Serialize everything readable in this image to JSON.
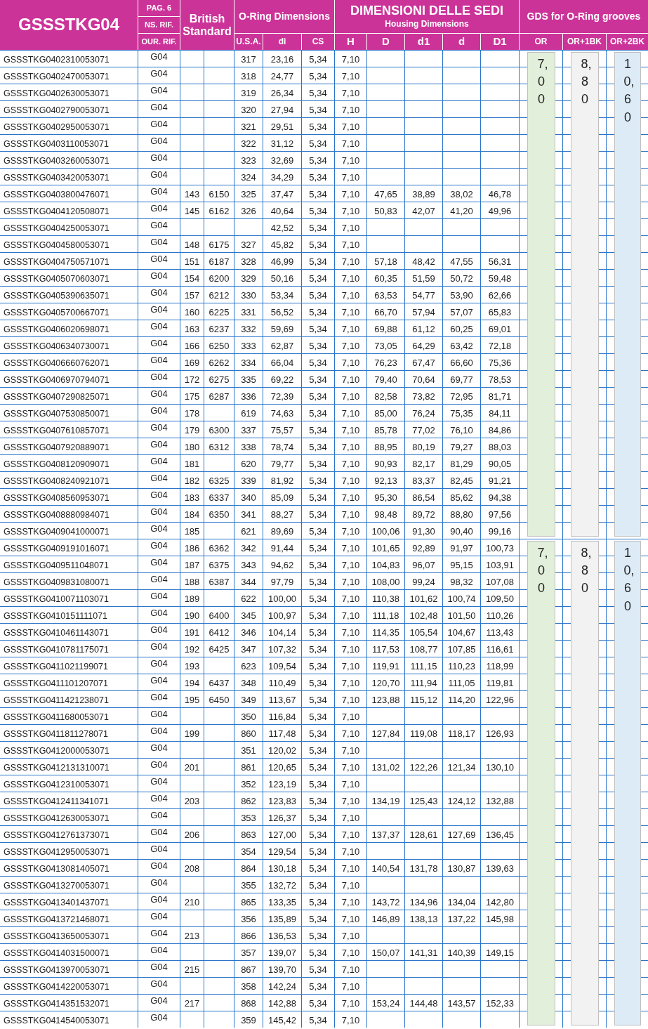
{
  "header": {
    "title": "GSSSTKG04",
    "page": "PAG. 6",
    "ns_ref": "NS. RIF.",
    "our_ref": "OUR. RIF.",
    "british_standard": "British Standard",
    "oring_group": "O-Ring Dimensions",
    "oring_columns": [
      "U.S.A.",
      "di",
      "CS"
    ],
    "housing_group": "DIMENSIONI DELLE SEDI",
    "housing_subtitle": "Housing Dimensions",
    "housing_columns": [
      "H",
      "D",
      "d1",
      "d",
      "D1"
    ],
    "grooves_group": "GDS for O-Ring grooves",
    "grooves_columns": [
      "OR",
      "OR+1BK",
      "OR+2BK"
    ]
  },
  "blocks": [
    {
      "grooves": [
        {
          "value": "7,00",
          "color": "#e2efda"
        },
        {
          "value": "8,80",
          "color": "#f2f2f2"
        },
        {
          "value": "10,60",
          "color": "#ddebf7"
        }
      ],
      "rows": [
        {
          "code": "GSSSTKG0402310053071",
          "ref": "G04",
          "usa": "317",
          "di": "23,16",
          "cs": "5,34",
          "h": "7,10"
        },
        {
          "code": "GSSSTKG0402470053071",
          "ref": "G04",
          "usa": "318",
          "di": "24,77",
          "cs": "5,34",
          "h": "7,10"
        },
        {
          "code": "GSSSTKG0402630053071",
          "ref": "G04",
          "usa": "319",
          "di": "26,34",
          "cs": "5,34",
          "h": "7,10"
        },
        {
          "code": "GSSSTKG0402790053071",
          "ref": "G04",
          "usa": "320",
          "di": "27,94",
          "cs": "5,34",
          "h": "7,10"
        },
        {
          "code": "GSSSTKG0402950053071",
          "ref": "G04",
          "usa": "321",
          "di": "29,51",
          "cs": "5,34",
          "h": "7,10"
        },
        {
          "code": "GSSSTKG0403110053071",
          "ref": "G04",
          "usa": "322",
          "di": "31,12",
          "cs": "5,34",
          "h": "7,10"
        },
        {
          "code": "GSSSTKG0403260053071",
          "ref": "G04",
          "usa": "323",
          "di": "32,69",
          "cs": "5,34",
          "h": "7,10"
        },
        {
          "code": "GSSSTKG0403420053071",
          "ref": "G04",
          "usa": "324",
          "di": "34,29",
          "cs": "5,34",
          "h": "7,10"
        },
        {
          "code": "GSSSTKG0403800476071",
          "ref": "G04",
          "bs_1": "143",
          "bs_2": "6150",
          "usa": "325",
          "di": "37,47",
          "cs": "5,34",
          "h": "7,10",
          "D": "47,65",
          "d1": "38,89",
          "d": "38,02",
          "D1": "46,78"
        },
        {
          "code": "GSSSTKG0404120508071",
          "ref": "G04",
          "bs_1": "145",
          "bs_2": "6162",
          "usa": "326",
          "di": "40,64",
          "cs": "5,34",
          "h": "7,10",
          "D": "50,83",
          "d1": "42,07",
          "d": "41,20",
          "D1": "49,96"
        },
        {
          "code": "GSSSTKG0404250053071",
          "ref": "G04",
          "di": "42,52",
          "cs": "5,34",
          "h": "7,10"
        },
        {
          "code": "GSSSTKG0404580053071",
          "ref": "G04",
          "bs_1": "148",
          "bs_2": "6175",
          "usa": "327",
          "di": "45,82",
          "cs": "5,34",
          "h": "7,10"
        },
        {
          "code": "GSSSTKG0404750571071",
          "ref": "G04",
          "bs_1": "151",
          "bs_2": "6187",
          "usa": "328",
          "di": "46,99",
          "cs": "5,34",
          "h": "7,10",
          "D": "57,18",
          "d1": "48,42",
          "d": "47,55",
          "D1": "56,31"
        },
        {
          "code": "GSSSTKG0405070603071",
          "ref": "G04",
          "bs_1": "154",
          "bs_2": "6200",
          "usa": "329",
          "di": "50,16",
          "cs": "5,34",
          "h": "7,10",
          "D": "60,35",
          "d1": "51,59",
          "d": "50,72",
          "D1": "59,48"
        },
        {
          "code": "GSSSTKG0405390635071",
          "ref": "G04",
          "bs_1": "157",
          "bs_2": "6212",
          "usa": "330",
          "di": "53,34",
          "cs": "5,34",
          "h": "7,10",
          "D": "63,53",
          "d1": "54,77",
          "d": "53,90",
          "D1": "62,66"
        },
        {
          "code": "GSSSTKG0405700667071",
          "ref": "G04",
          "bs_1": "160",
          "bs_2": "6225",
          "usa": "331",
          "di": "56,52",
          "cs": "5,34",
          "h": "7,10",
          "D": "66,70",
          "d1": "57,94",
          "d": "57,07",
          "D1": "65,83"
        },
        {
          "code": "GSSSTKG0406020698071",
          "ref": "G04",
          "bs_1": "163",
          "bs_2": "6237",
          "usa": "332",
          "di": "59,69",
          "cs": "5,34",
          "h": "7,10",
          "D": "69,88",
          "d1": "61,12",
          "d": "60,25",
          "D1": "69,01"
        },
        {
          "code": "GSSSTKG0406340730071",
          "ref": "G04",
          "bs_1": "166",
          "bs_2": "6250",
          "usa": "333",
          "di": "62,87",
          "cs": "5,34",
          "h": "7,10",
          "D": "73,05",
          "d1": "64,29",
          "d": "63,42",
          "D1": "72,18"
        },
        {
          "code": "GSSSTKG0406660762071",
          "ref": "G04",
          "bs_1": "169",
          "bs_2": "6262",
          "usa": "334",
          "di": "66,04",
          "cs": "5,34",
          "h": "7,10",
          "D": "76,23",
          "d1": "67,47",
          "d": "66,60",
          "D1": "75,36"
        },
        {
          "code": "GSSSTKG0406970794071",
          "ref": "G04",
          "bs_1": "172",
          "bs_2": "6275",
          "usa": "335",
          "di": "69,22",
          "cs": "5,34",
          "h": "7,10",
          "D": "79,40",
          "d1": "70,64",
          "d": "69,77",
          "D1": "78,53"
        },
        {
          "code": "GSSSTKG0407290825071",
          "ref": "G04",
          "bs_1": "175",
          "bs_2": "6287",
          "usa": "336",
          "di": "72,39",
          "cs": "5,34",
          "h": "7,10",
          "D": "82,58",
          "d1": "73,82",
          "d": "72,95",
          "D1": "81,71"
        },
        {
          "code": "GSSSTKG0407530850071",
          "ref": "G04",
          "bs_1": "178",
          "usa": "619",
          "di": "74,63",
          "cs": "5,34",
          "h": "7,10",
          "D": "85,00",
          "d1": "76,24",
          "d": "75,35",
          "D1": "84,11"
        },
        {
          "code": "GSSSTKG0407610857071",
          "ref": "G04",
          "bs_1": "179",
          "bs_2": "6300",
          "usa": "337",
          "di": "75,57",
          "cs": "5,34",
          "h": "7,10",
          "D": "85,78",
          "d1": "77,02",
          "d": "76,10",
          "D1": "84,86"
        },
        {
          "code": "GSSSTKG0407920889071",
          "ref": "G04",
          "bs_1": "180",
          "bs_2": "6312",
          "usa": "338",
          "di": "78,74",
          "cs": "5,34",
          "h": "7,10",
          "D": "88,95",
          "d1": "80,19",
          "d": "79,27",
          "D1": "88,03"
        },
        {
          "code": "GSSSTKG0408120909071",
          "ref": "G04",
          "bs_1": "181",
          "usa": "620",
          "di": "79,77",
          "cs": "5,34",
          "h": "7,10",
          "D": "90,93",
          "d1": "82,17",
          "d": "81,29",
          "D1": "90,05"
        },
        {
          "code": "GSSSTKG0408240921071",
          "ref": "G04",
          "bs_1": "182",
          "bs_2": "6325",
          "usa": "339",
          "di": "81,92",
          "cs": "5,34",
          "h": "7,10",
          "D": "92,13",
          "d1": "83,37",
          "d": "82,45",
          "D1": "91,21"
        },
        {
          "code": "GSSSTKG0408560953071",
          "ref": "G04",
          "bs_1": "183",
          "bs_2": "6337",
          "usa": "340",
          "di": "85,09",
          "cs": "5,34",
          "h": "7,10",
          "D": "95,30",
          "d1": "86,54",
          "d": "85,62",
          "D1": "94,38"
        },
        {
          "code": "GSSSTKG0408880984071",
          "ref": "G04",
          "bs_1": "184",
          "bs_2": "6350",
          "usa": "341",
          "di": "88,27",
          "cs": "5,34",
          "h": "7,10",
          "D": "98,48",
          "d1": "89,72",
          "d": "88,80",
          "D1": "97,56"
        },
        {
          "code": "GSSSTKG0409041000071",
          "ref": "G04",
          "bs_1": "185",
          "usa": "621",
          "di": "89,69",
          "cs": "5,34",
          "h": "7,10",
          "D": "100,06",
          "d1": "91,30",
          "d": "90,40",
          "D1": "99,16"
        }
      ]
    },
    {
      "grooves": [
        {
          "value": "7,00",
          "color": "#e2efda"
        },
        {
          "value": "8,80",
          "color": "#f2f2f2"
        },
        {
          "value": "10,60",
          "color": "#ddebf7"
        }
      ],
      "rows": [
        {
          "code": "GSSSTKG0409191016071",
          "ref": "G04",
          "bs_1": "186",
          "bs_2": "6362",
          "usa": "342",
          "di": "91,44",
          "cs": "5,34",
          "h": "7,10",
          "D": "101,65",
          "d1": "92,89",
          "d": "91,97",
          "D1": "100,73"
        },
        {
          "code": "GSSSTKG0409511048071",
          "ref": "G04",
          "bs_1": "187",
          "bs_2": "6375",
          "usa": "343",
          "di": "94,62",
          "cs": "5,34",
          "h": "7,10",
          "D": "104,83",
          "d1": "96,07",
          "d": "95,15",
          "D1": "103,91"
        },
        {
          "code": "GSSSTKG0409831080071",
          "ref": "G04",
          "bs_1": "188",
          "bs_2": "6387",
          "usa": "344",
          "di": "97,79",
          "cs": "5,34",
          "h": "7,10",
          "D": "108,00",
          "d1": "99,24",
          "d": "98,32",
          "D1": "107,08"
        },
        {
          "code": "GSSSTKG0410071103071",
          "ref": "G04",
          "bs_1": "189",
          "usa": "622",
          "di": "100,00",
          "cs": "5,34",
          "h": "7,10",
          "D": "110,38",
          "d1": "101,62",
          "d": "100,74",
          "D1": "109,50"
        },
        {
          "code": "GSSSTKG0410151111071",
          "ref": "G04",
          "bs_1": "190",
          "bs_2": "6400",
          "usa": "345",
          "di": "100,97",
          "cs": "5,34",
          "h": "7,10",
          "D": "111,18",
          "d1": "102,48",
          "d": "101,50",
          "D1": "110,26"
        },
        {
          "code": "GSSSTKG0410461143071",
          "ref": "G04",
          "bs_1": "191",
          "bs_2": "6412",
          "usa": "346",
          "di": "104,14",
          "cs": "5,34",
          "h": "7,10",
          "D": "114,35",
          "d1": "105,54",
          "d": "104,67",
          "D1": "113,43"
        },
        {
          "code": "GSSSTKG0410781175071",
          "ref": "G04",
          "bs_1": "192",
          "bs_2": "6425",
          "usa": "347",
          "di": "107,32",
          "cs": "5,34",
          "h": "7,10",
          "D": "117,53",
          "d1": "108,77",
          "d": "107,85",
          "D1": "116,61"
        },
        {
          "code": "GSSSTKG0411021199071",
          "ref": "G04",
          "bs_1": "193",
          "usa": "623",
          "di": "109,54",
          "cs": "5,34",
          "h": "7,10",
          "D": "119,91",
          "d1": "111,15",
          "d": "110,23",
          "D1": "118,99"
        },
        {
          "code": "GSSSTKG0411101207071",
          "ref": "G04",
          "bs_1": "194",
          "bs_2": "6437",
          "usa": "348",
          "di": "110,49",
          "cs": "5,34",
          "h": "7,10",
          "D": "120,70",
          "d1": "111,94",
          "d": "111,05",
          "D1": "119,81"
        },
        {
          "code": "GSSSTKG0411421238071",
          "ref": "G04",
          "bs_1": "195",
          "bs_2": "6450",
          "usa": "349",
          "di": "113,67",
          "cs": "5,34",
          "h": "7,10",
          "D": "123,88",
          "d1": "115,12",
          "d": "114,20",
          "D1": "122,96"
        },
        {
          "code": "GSSSTKG0411680053071",
          "ref": "G04",
          "usa": "350",
          "di": "116,84",
          "cs": "5,34",
          "h": "7,10"
        },
        {
          "code": "GSSSTKG0411811278071",
          "ref": "G04",
          "bs_1": "199",
          "usa": "860",
          "di": "117,48",
          "cs": "5,34",
          "h": "7,10",
          "D": "127,84",
          "d1": "119,08",
          "d": "118,17",
          "D1": "126,93"
        },
        {
          "code": "GSSSTKG0412000053071",
          "ref": "G04",
          "usa": "351",
          "di": "120,02",
          "cs": "5,34",
          "h": "7,10"
        },
        {
          "code": "GSSSTKG0412131310071",
          "ref": "G04",
          "bs_1": "201",
          "usa": "861",
          "di": "120,65",
          "cs": "5,34",
          "h": "7,10",
          "D": "131,02",
          "d1": "122,26",
          "d": "121,34",
          "D1": "130,10"
        },
        {
          "code": "GSSSTKG0412310053071",
          "ref": "G04",
          "usa": "352",
          "di": "123,19",
          "cs": "5,34",
          "h": "7,10"
        },
        {
          "code": "GSSSTKG0412411341071",
          "ref": "G04",
          "bs_1": "203",
          "usa": "862",
          "di": "123,83",
          "cs": "5,34",
          "h": "7,10",
          "D": "134,19",
          "d1": "125,43",
          "d": "124,12",
          "D1": "132,88"
        },
        {
          "code": "GSSSTKG0412630053071",
          "ref": "G04",
          "usa": "353",
          "di": "126,37",
          "cs": "5,34",
          "h": "7,10"
        },
        {
          "code": "GSSSTKG0412761373071",
          "ref": "G04",
          "bs_1": "206",
          "usa": "863",
          "di": "127,00",
          "cs": "5,34",
          "h": "7,10",
          "D": "137,37",
          "d1": "128,61",
          "d": "127,69",
          "D1": "136,45"
        },
        {
          "code": "GSSSTKG0412950053071",
          "ref": "G04",
          "usa": "354",
          "di": "129,54",
          "cs": "5,34",
          "h": "7,10"
        },
        {
          "code": "GSSSTKG0413081405071",
          "ref": "G04",
          "bs_1": "208",
          "usa": "864",
          "di": "130,18",
          "cs": "5,34",
          "h": "7,10",
          "D": "140,54",
          "d1": "131,78",
          "d": "130,87",
          "D1": "139,63"
        },
        {
          "code": "GSSSTKG0413270053071",
          "ref": "G04",
          "usa": "355",
          "di": "132,72",
          "cs": "5,34",
          "h": "7,10"
        },
        {
          "code": "GSSSTKG0413401437071",
          "ref": "G04",
          "bs_1": "210",
          "usa": "865",
          "di": "133,35",
          "cs": "5,34",
          "h": "7,10",
          "D": "143,72",
          "d1": "134,96",
          "d": "134,04",
          "D1": "142,80"
        },
        {
          "code": "GSSSTKG0413721468071",
          "ref": "G04",
          "usa": "356",
          "di": "135,89",
          "cs": "5,34",
          "h": "7,10",
          "D": "146,89",
          "d1": "138,13",
          "d": "137,22",
          "D1": "145,98"
        },
        {
          "code": "GSSSTKG0413650053071",
          "ref": "G04",
          "bs_1": "213",
          "usa": "866",
          "di": "136,53",
          "cs": "5,34",
          "h": "7,10"
        },
        {
          "code": "GSSSTKG0414031500071",
          "ref": "G04",
          "usa": "357",
          "di": "139,07",
          "cs": "5,34",
          "h": "7,10",
          "D": "150,07",
          "d1": "141,31",
          "d": "140,39",
          "D1": "149,15"
        },
        {
          "code": "GSSSTKG0413970053071",
          "ref": "G04",
          "bs_1": "215",
          "usa": "867",
          "di": "139,70",
          "cs": "5,34",
          "h": "7,10"
        },
        {
          "code": "GSSSTKG0414220053071",
          "ref": "G04",
          "usa": "358",
          "di": "142,24",
          "cs": "5,34",
          "h": "7,10"
        },
        {
          "code": "GSSSTKG0414351532071",
          "ref": "G04",
          "bs_1": "217",
          "usa": "868",
          "di": "142,88",
          "cs": "5,34",
          "h": "7,10",
          "D": "153,24",
          "d1": "144,48",
          "d": "143,57",
          "D1": "152,33"
        },
        {
          "code": "GSSSTKG0414540053071",
          "ref": "G04",
          "usa": "359",
          "di": "145,42",
          "cs": "5,34",
          "h": "7,10"
        }
      ]
    }
  ]
}
